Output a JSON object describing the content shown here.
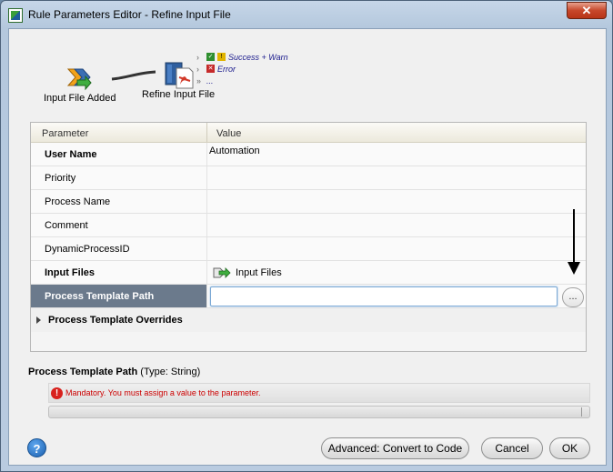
{
  "window": {
    "title": "Rule Parameters Editor - Refine Input File",
    "close_glyph": "✕"
  },
  "workflow": {
    "source_label": "Input File Added",
    "target_label": "Refine Input File",
    "outlets": [
      {
        "label": "Success + Warn"
      },
      {
        "label": "Error"
      },
      {
        "label": "..."
      }
    ]
  },
  "grid": {
    "headers": {
      "parameter": "Parameter",
      "value": "Value"
    },
    "rows": [
      {
        "name": "User Name",
        "value": "Automation",
        "bold": true
      },
      {
        "name": "Priority",
        "value": ""
      },
      {
        "name": "Process Name",
        "value": ""
      },
      {
        "name": "Comment",
        "value": ""
      },
      {
        "name": "DynamicProcessID",
        "value": ""
      },
      {
        "name": "Input Files",
        "value": "Input Files",
        "bold": true
      },
      {
        "name": "Process Template Path",
        "value": "",
        "selected": true
      }
    ],
    "browse_label": "...",
    "group": {
      "name": "Process Template Overrides"
    }
  },
  "description": {
    "param_name": "Process Template Path",
    "type_text": "(Type: String)",
    "error_message": "Mandatory. You must assign a value to the parameter."
  },
  "footer": {
    "help_glyph": "?",
    "advanced_label": "Advanced: Convert to Code",
    "cancel_label": "Cancel",
    "ok_label": "OK"
  }
}
